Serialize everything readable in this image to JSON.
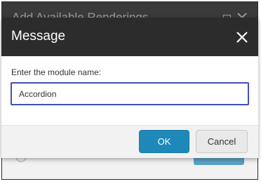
{
  "background_window": {
    "title": "Add Available Renderings"
  },
  "dialog": {
    "title": "Message",
    "field_label": "Enter the module name:",
    "input_value": "Accordion",
    "ok_label": "OK",
    "cancel_label": "Cancel"
  },
  "icons": {
    "close": "close-icon",
    "maximize": "maximize-icon",
    "info": "info-icon"
  },
  "colors": {
    "header_bg": "#2c2c2c",
    "primary_button": "#1e88b8",
    "input_focus_border": "#3f51b5"
  }
}
